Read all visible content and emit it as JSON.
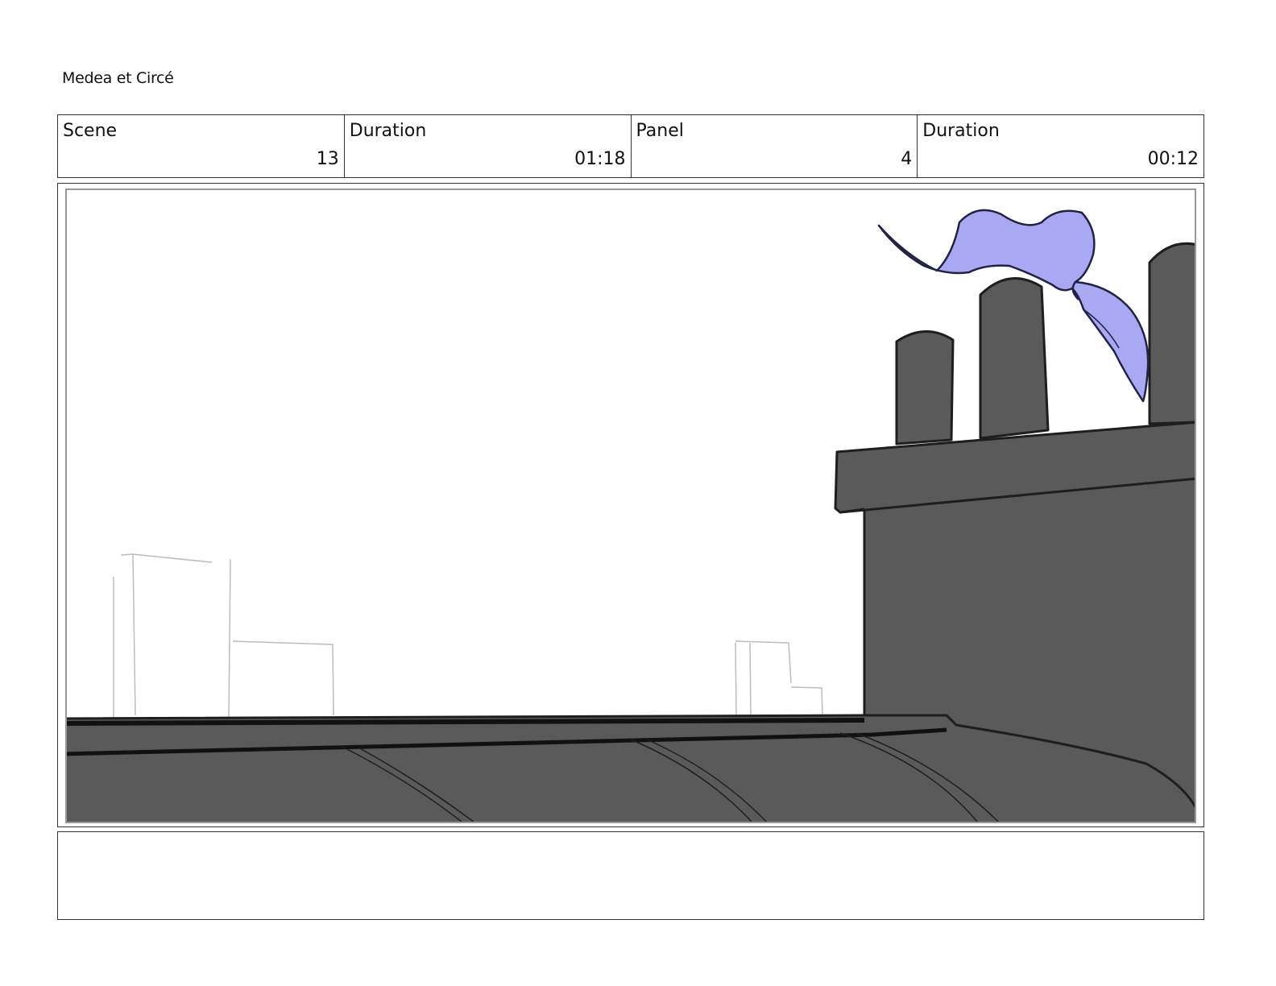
{
  "document": {
    "title": "Medea et Circé"
  },
  "info": {
    "scene_label": "Scene",
    "scene_value": "13",
    "scene_duration_label": "Duration",
    "scene_duration_value": "01:18",
    "panel_label": "Panel",
    "panel_value": "4",
    "panel_duration_label": "Duration",
    "panel_duration_value": "00:12"
  },
  "panel_art": {
    "description_colors": {
      "building_fill": "#5a5a5a",
      "outline": "#1e1e1e",
      "scarf_fill": "#a9a8f2",
      "sketch_line": "#b8b8b8"
    }
  },
  "notes": {
    "text": ""
  }
}
